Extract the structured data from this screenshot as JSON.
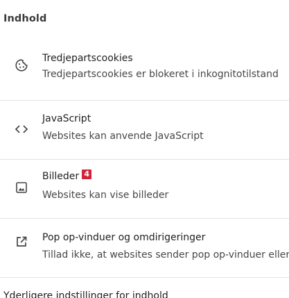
{
  "section": {
    "title": "Indhold"
  },
  "rows": [
    {
      "icon": "cookie-icon",
      "title": "Tredjepartscookies",
      "subtitle": "Tredjepartscookies er blokeret i inkognitotilstand"
    },
    {
      "icon": "code-icon",
      "title": "JavaScript",
      "subtitle": "Websites kan anvende JavaScript"
    },
    {
      "icon": "image-icon",
      "title": "Billeder",
      "badge": "4",
      "subtitle": "Websites kan vise billeder"
    },
    {
      "icon": "open-in-new-icon",
      "title": "Pop op-vinduer og omdirigeringer",
      "subtitle": "Tillad ikke, at websites sender pop op-vinduer eller bruger omdirigeringer"
    }
  ],
  "footer": {
    "cut_label": "Yderligere indstillinger for indhold"
  },
  "colors": {
    "badge": "#d0243a",
    "divider": "#e3e3e3"
  }
}
